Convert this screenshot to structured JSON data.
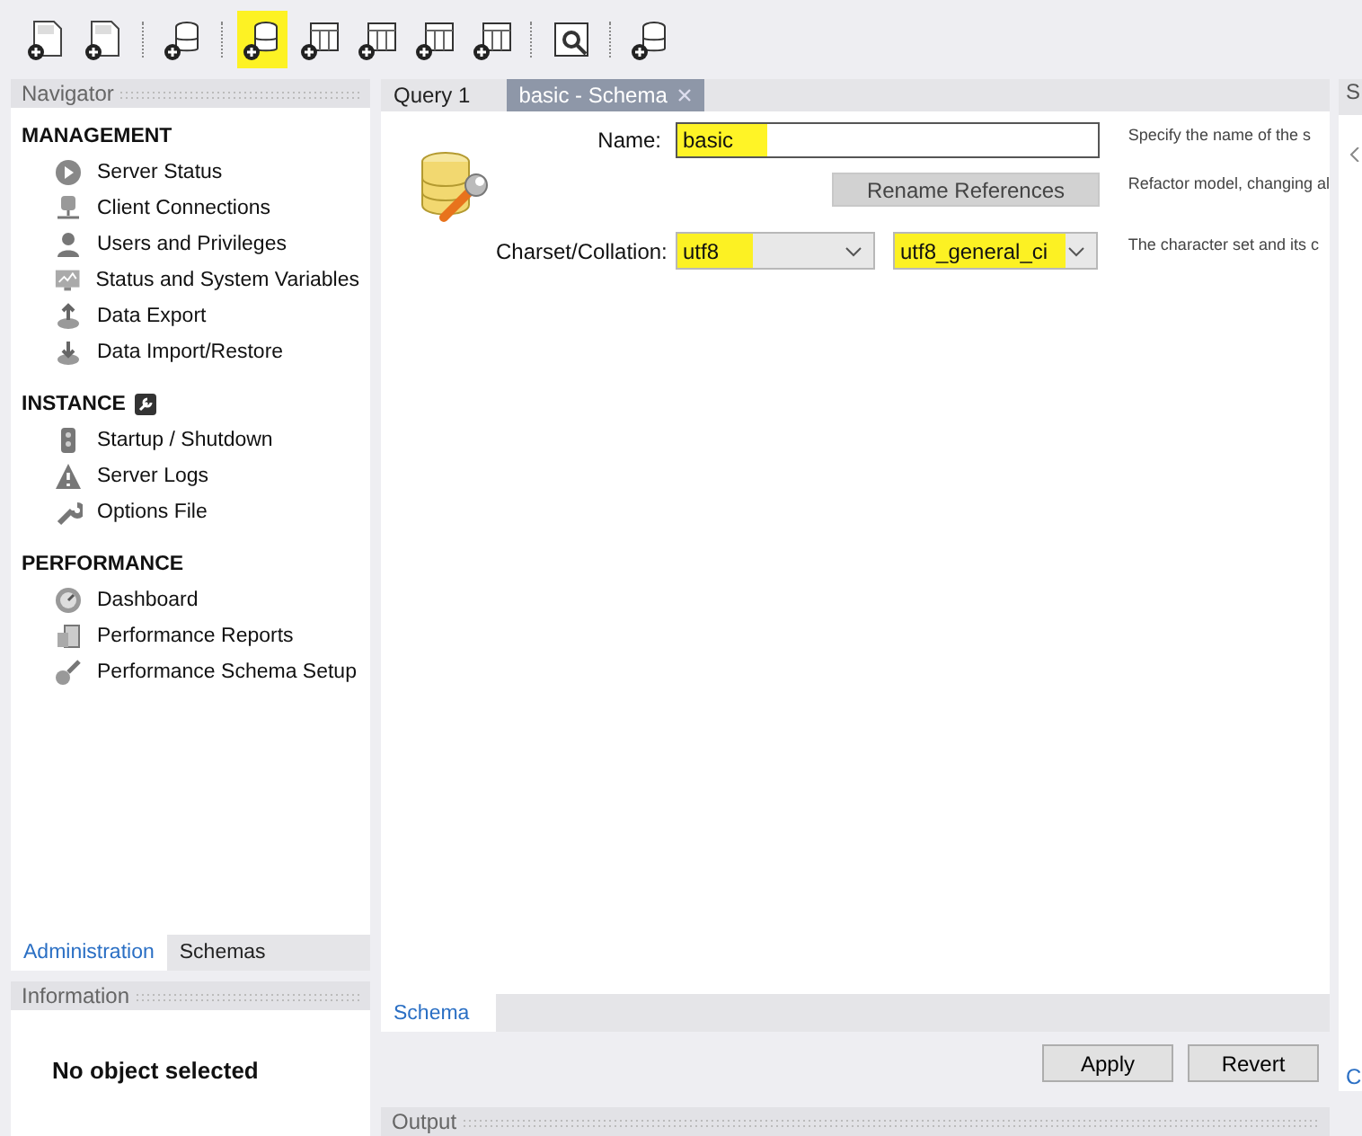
{
  "toolbar": [
    {
      "highlighted": false
    },
    {
      "highlighted": false
    },
    {
      "highlighted": false
    },
    {
      "highlighted": true
    },
    {
      "highlighted": false
    },
    {
      "highlighted": false
    },
    {
      "highlighted": false
    },
    {
      "highlighted": false
    },
    {
      "highlighted": false
    },
    {
      "highlighted": false
    }
  ],
  "navigator": {
    "title": "Navigator",
    "sections": [
      {
        "title": "MANAGEMENT",
        "items": [
          "Server Status",
          "Client Connections",
          "Users and Privileges",
          "Status and System Variables",
          "Data Export",
          "Data Import/Restore"
        ]
      },
      {
        "title": "INSTANCE",
        "items": [
          "Startup / Shutdown",
          "Server Logs",
          "Options File"
        ]
      },
      {
        "title": "PERFORMANCE",
        "items": [
          "Dashboard",
          "Performance Reports",
          "Performance Schema Setup"
        ]
      }
    ],
    "tabs": [
      {
        "label": "Administration",
        "selected": true
      },
      {
        "label": "Schemas",
        "selected": false
      }
    ]
  },
  "information": {
    "title": "Information",
    "message": "No object selected"
  },
  "editor_tabs": [
    {
      "label": "Query 1",
      "selected": false,
      "closable": false
    },
    {
      "label": "basic - Schema",
      "selected": true,
      "closable": true
    }
  ],
  "schema": {
    "name_label": "Name:",
    "name_value": "basic",
    "name_highlighted": true,
    "rename_button": "Rename References",
    "charset_label": "Charset/Collation:",
    "charset": {
      "value": "utf8",
      "highlighted": true
    },
    "collation": {
      "value": "utf8_general_ci",
      "highlighted": true
    },
    "hints": [
      "Specify the name of the s",
      "Refactor model, changing al",
      "The character set and its c"
    ]
  },
  "bottom_tabs": [
    {
      "label": "Schema",
      "selected": true
    }
  ],
  "buttons": [
    "Apply",
    "Revert"
  ],
  "output": {
    "title": "Output"
  },
  "side_panel": {
    "title": "S",
    "link": "C"
  }
}
